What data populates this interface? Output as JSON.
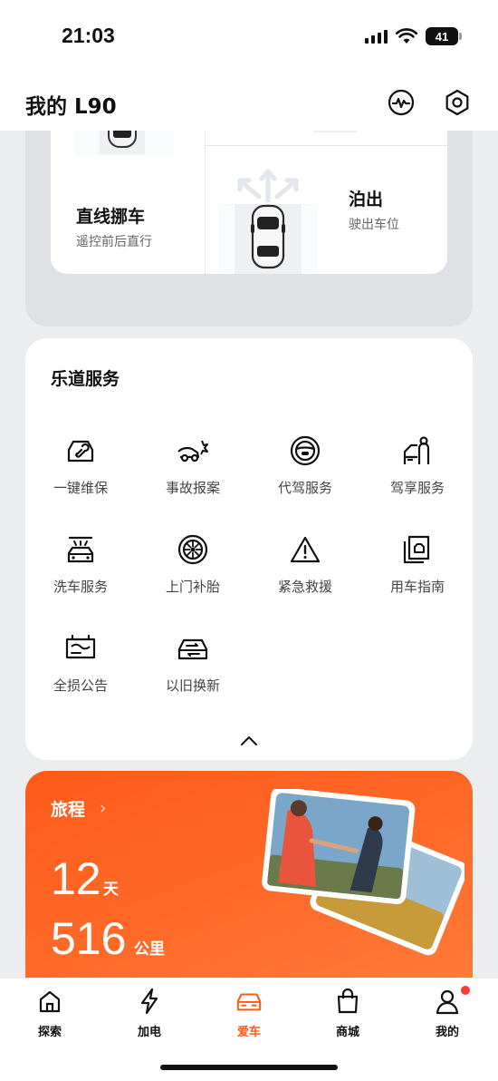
{
  "status_bar": {
    "time": "21:03",
    "battery": "41"
  },
  "header": {
    "title": "我的 L90",
    "activity_icon": "activity-icon",
    "settings_icon": "hexagon-settings-icon"
  },
  "parking": {
    "straight": {
      "title": "直线挪车",
      "subtitle": "遥控前后直行"
    },
    "exit": {
      "title": "泊出",
      "subtitle": "驶出车位"
    }
  },
  "services": {
    "title": "乐道服务",
    "items": [
      {
        "label": "一键维保",
        "icon": "car-wrench-icon"
      },
      {
        "label": "事故报案",
        "icon": "car-crash-icon"
      },
      {
        "label": "代驾服务",
        "icon": "steering-wheel-icon"
      },
      {
        "label": "驾享服务",
        "icon": "person-door-icon"
      },
      {
        "label": "洗车服务",
        "icon": "car-wash-icon"
      },
      {
        "label": "上门补胎",
        "icon": "tire-icon"
      },
      {
        "label": "紧急救援",
        "icon": "warning-triangle-icon"
      },
      {
        "label": "用车指南",
        "icon": "guide-book-icon"
      },
      {
        "label": "全损公告",
        "icon": "battery-notice-icon"
      },
      {
        "label": "以旧换新",
        "icon": "car-trade-in-icon"
      }
    ]
  },
  "trip": {
    "title": "旅程",
    "days": "12",
    "days_unit": "天",
    "distance": "516",
    "distance_unit": "公里"
  },
  "tabs": [
    {
      "label": "探索",
      "icon": "home-icon",
      "active": false
    },
    {
      "label": "加电",
      "icon": "lightning-icon",
      "active": false
    },
    {
      "label": "爱车",
      "icon": "car-icon",
      "active": true
    },
    {
      "label": "商城",
      "icon": "shopping-bag-icon",
      "active": false
    },
    {
      "label": "我的",
      "icon": "user-icon",
      "active": false
    }
  ],
  "colors": {
    "accent": "#ff5a1a",
    "background": "#ebedef",
    "notification": "#ff3b30"
  }
}
